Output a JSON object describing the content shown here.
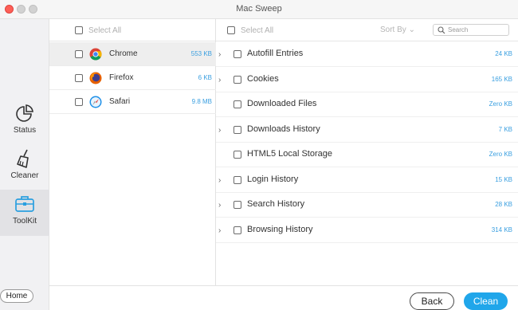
{
  "window": {
    "title": "Mac Sweep"
  },
  "sidebar": {
    "items": [
      {
        "label": "Status",
        "icon": "pie-chart-icon"
      },
      {
        "label": "Cleaner",
        "icon": "broom-icon"
      },
      {
        "label": "ToolKit",
        "icon": "toolkit-icon",
        "active": true
      }
    ],
    "home_label": "Home"
  },
  "browsers": {
    "select_all_label": "Select All",
    "items": [
      {
        "name": "Chrome",
        "size": "553 KB",
        "icon": "chrome-icon",
        "selected": true
      },
      {
        "name": "Firefox",
        "size": "6 KB",
        "icon": "firefox-icon"
      },
      {
        "name": "Safari",
        "size": "9.8 MB",
        "icon": "safari-icon"
      }
    ]
  },
  "items": {
    "select_all_label": "Select All",
    "sort_by_label": "Sort By",
    "search_placeholder": "Search",
    "rows": [
      {
        "name": "Autofill Entries",
        "size": "24 KB",
        "expandable": true
      },
      {
        "name": "Cookies",
        "size": "165 KB",
        "expandable": true
      },
      {
        "name": "Downloaded Files",
        "size": "Zero KB",
        "expandable": false
      },
      {
        "name": "Downloads History",
        "size": "7 KB",
        "expandable": true
      },
      {
        "name": "HTML5 Local Storage",
        "size": "Zero KB",
        "expandable": false
      },
      {
        "name": "Login History",
        "size": "15 KB",
        "expandable": true
      },
      {
        "name": "Search History",
        "size": "28 KB",
        "expandable": true
      },
      {
        "name": "Browsing History",
        "size": "314 KB",
        "expandable": true
      }
    ]
  },
  "footer": {
    "back_label": "Back",
    "clean_label": "Clean"
  },
  "colors": {
    "accent": "#20a6ea",
    "size_text": "#3a9fe0",
    "close_dot": "#fd5f57"
  }
}
